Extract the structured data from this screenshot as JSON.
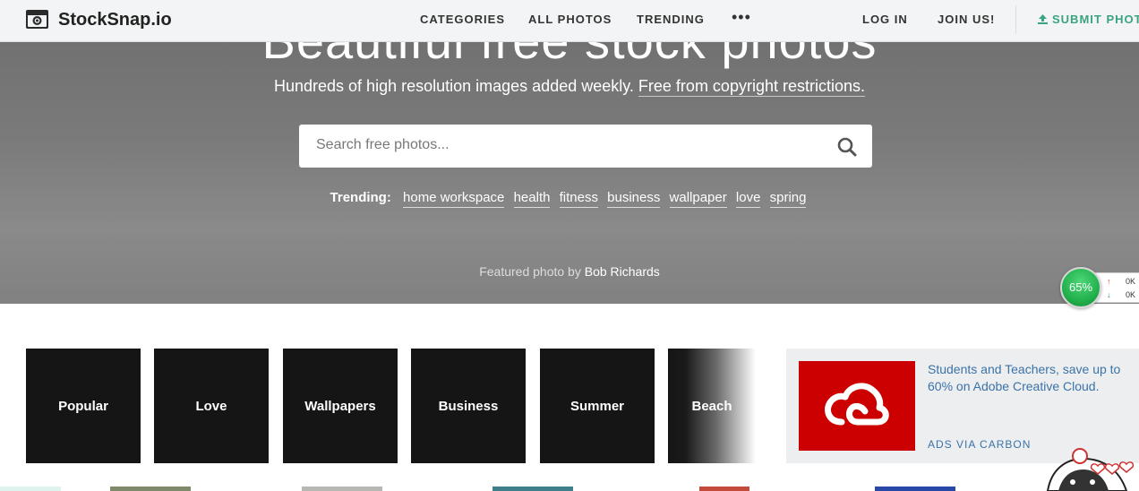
{
  "navbar": {
    "brand": "StockSnap.io",
    "links": [
      "CATEGORIES",
      "ALL PHOTOS",
      "TRENDING"
    ],
    "more": "•••",
    "login": "LOG IN",
    "join": "JOIN US!",
    "submit": "SUBMIT PHOTO"
  },
  "hero": {
    "title": "Beautiful free stock photos",
    "subtitle": "Hundreds of high resolution images added weekly.",
    "subtitle_link": "Free from copyright restrictions.",
    "search_placeholder": "Search free photos...",
    "trending_label": "Trending:",
    "trending_tags": [
      "home workspace",
      "health",
      "fitness",
      "business",
      "wallpaper",
      "love",
      "spring"
    ],
    "featured_prefix": "Featured photo by",
    "featured_author": "Bob Richards"
  },
  "widget": {
    "percent": "65%",
    "up_value": "0K",
    "down_value": "0K"
  },
  "categories": [
    "Popular",
    "Love",
    "Wallpapers",
    "Business",
    "Summer",
    "Beach"
  ],
  "ad": {
    "text": "Students and Teachers, save up to 60% on Adobe Creative Cloud.",
    "via": "ADS VIA CARBON"
  },
  "colors": {
    "accent_green": "#3aa380",
    "ad_red": "#cc0000",
    "link_blue": "#3b73a8"
  }
}
